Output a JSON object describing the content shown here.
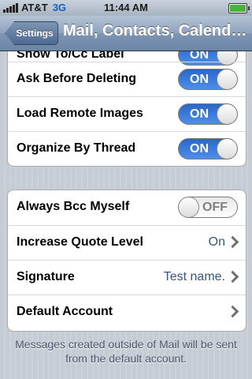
{
  "status_bar": {
    "carrier": "AT&T",
    "network": "3G",
    "time": "11:44 AM",
    "signal_bars": 5,
    "battery_level": "full"
  },
  "nav": {
    "back_label": "Settings",
    "title": "Mail, Contacts, Calendars"
  },
  "group1": {
    "rows": [
      {
        "label": "Show To/Cc Label",
        "state": "ON"
      },
      {
        "label": "Ask Before Deleting",
        "state": "ON"
      },
      {
        "label": "Load Remote Images",
        "state": "ON"
      },
      {
        "label": "Organize By Thread",
        "state": "ON"
      }
    ]
  },
  "group2": {
    "rows": [
      {
        "label": "Always Bcc Myself",
        "state": "OFF"
      },
      {
        "label": "Increase Quote Level",
        "value": "On"
      },
      {
        "label": "Signature",
        "value": "Test name."
      },
      {
        "label": "Default Account",
        "value": ""
      }
    ]
  },
  "footer": {
    "text": "Messages created outside of Mail will be sent from the default account."
  },
  "colors": {
    "switch_on": "#2b66c7",
    "value_text": "#385487",
    "nav_bar": "#7e94b2"
  }
}
